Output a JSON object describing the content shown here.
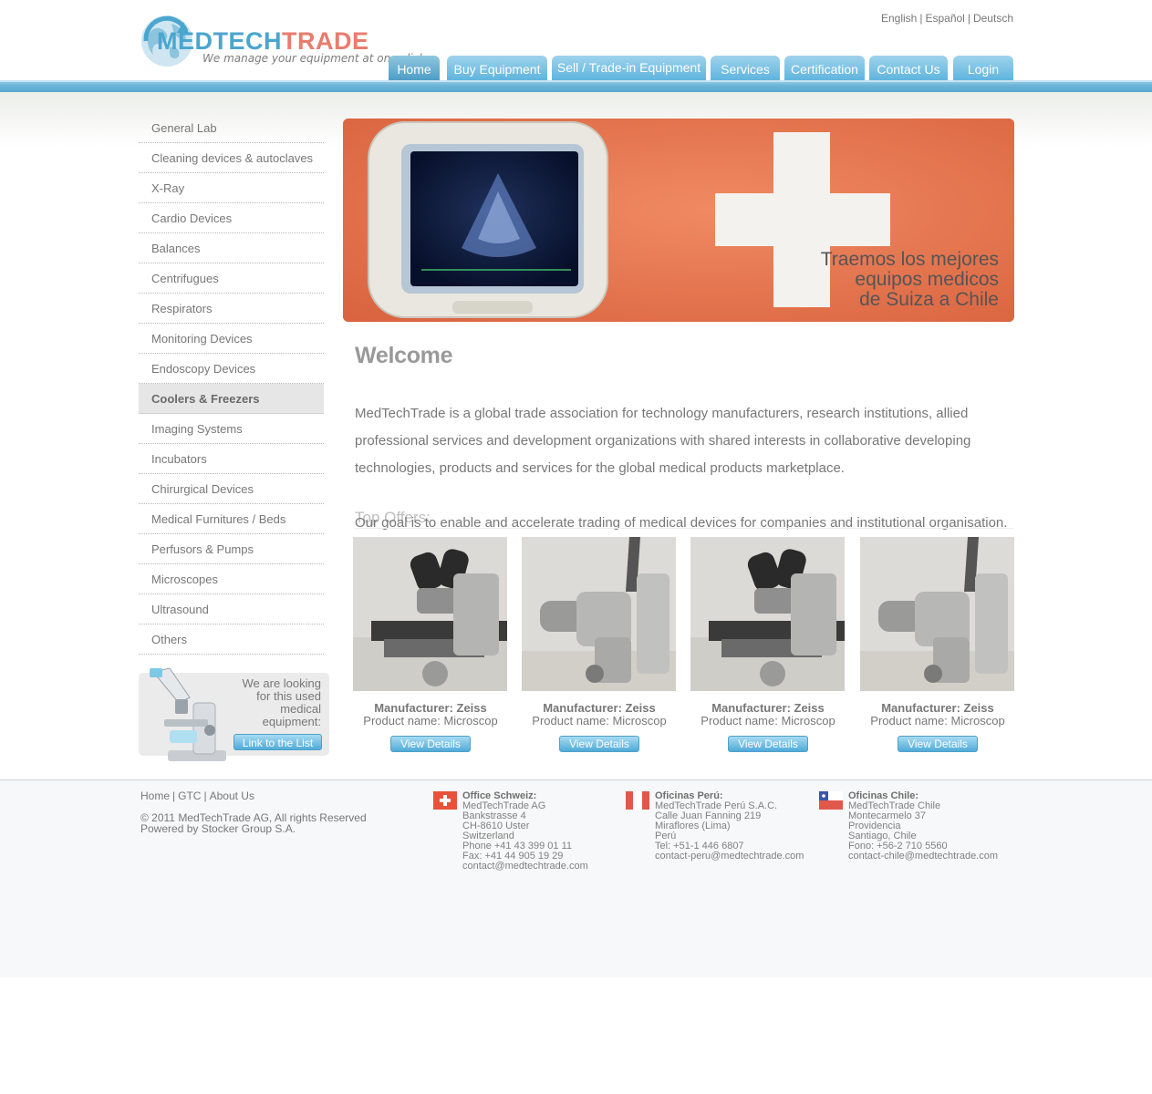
{
  "logo": {
    "part1": "MEDTECH",
    "part2": "TRADE",
    "tagline": "We manage your equipment at one click"
  },
  "languages": [
    "English",
    "Español",
    "Deutsch"
  ],
  "nav": {
    "tabs": [
      {
        "label": "Home",
        "active": true
      },
      {
        "label": "Buy Equipment"
      },
      {
        "label": "Sell / Trade-in Equipment"
      },
      {
        "label": "Services"
      },
      {
        "label": "Certification"
      },
      {
        "label": "Contact Us"
      },
      {
        "label": "Login"
      }
    ]
  },
  "sidebar": {
    "items": [
      {
        "label": "General Lab"
      },
      {
        "label": "Cleaning devices & autoclaves"
      },
      {
        "label": "X-Ray"
      },
      {
        "label": "Cardio Devices"
      },
      {
        "label": "Balances"
      },
      {
        "label": "Centrifugues"
      },
      {
        "label": "Respirators"
      },
      {
        "label": "Monitoring Devices"
      },
      {
        "label": "Endoscopy Devices"
      },
      {
        "label": "Coolers & Freezers",
        "active": true
      },
      {
        "label": "Imaging Systems"
      },
      {
        "label": "Incubators"
      },
      {
        "label": "Chirurgical Devices"
      },
      {
        "label": "Medical Furnitures / Beds"
      },
      {
        "label": "Perfusors & Pumps"
      },
      {
        "label": "Microscopes"
      },
      {
        "label": "Ultrasound"
      },
      {
        "label": "Others"
      }
    ],
    "promo": {
      "line1": "We are looking",
      "line2": "for this used",
      "line3": "medical",
      "line4": "equipment:",
      "button": "Link to the List"
    }
  },
  "banner": {
    "line1": "Traemos los mejores",
    "line2": "equipos medicos",
    "line3": "de Suiza a Chile"
  },
  "main": {
    "welcome": "Welcome",
    "intro": "MedTechTrade is a global trade association for technology manufacturers, research institutions, allied professional services and development organizations with shared interests in collaborative developing technologies, products and services for the global medical products marketplace.",
    "goal": "Our goal is to enable and accelerate trading of medical devices for companies and institutional organisation.",
    "top_offers": "Top Offers:"
  },
  "offers": [
    {
      "manufacturer": "Manufacturer: Zeiss",
      "product": "Product name: Microscop",
      "button": "View Details",
      "kind": "upright"
    },
    {
      "manufacturer": "Manufacturer: Zeiss",
      "product": "Product name: Microscop",
      "button": "View Details",
      "kind": "surgical"
    },
    {
      "manufacturer": "Manufacturer: Zeiss",
      "product": "Product name: Microscop",
      "button": "View Details",
      "kind": "upright"
    },
    {
      "manufacturer": "Manufacturer: Zeiss",
      "product": "Product name: Microscop",
      "button": "View Details",
      "kind": "surgical"
    }
  ],
  "footer": {
    "links": [
      "Home",
      "GTC",
      "About Us"
    ],
    "copyright": "© 2011 MedTechTrade AG, All rights Reserved",
    "powered": "Powered by Stocker Group S.A.",
    "offices": [
      {
        "title": "Office Schweiz:",
        "flag": "switzerland",
        "lines": [
          "MedTechTrade AG",
          "Bankstrasse 4",
          "CH-8610 Uster",
          "Switzerland",
          "Phone +41 43 399 01 11",
          "Fax: +41 44 905 19 29",
          "contact@medtechtrade.com"
        ]
      },
      {
        "title": "Oficinas Perú:",
        "flag": "peru",
        "lines": [
          "MedTechTrade Perú S.A.C.",
          "Calle Juan Fanning 219",
          "Miraflores (Lima)",
          "Perú",
          "Tel: +51-1 446 6807",
          "contact-peru@medtechtrade.com"
        ]
      },
      {
        "title": "Oficinas Chile:",
        "flag": "chile",
        "lines": [
          "MedTechTrade Chile",
          "Montecarmelo 37",
          "Providencia",
          "Santiago, Chile",
          "Fono: +56-2 710 5560",
          "contact-chile@medtechtrade.com"
        ]
      }
    ]
  },
  "colors": {
    "brand_blue": "#4aa6cf",
    "brand_red": "#ea7c6e",
    "banner_orange": "#e57a55",
    "text_gray": "#777777"
  }
}
